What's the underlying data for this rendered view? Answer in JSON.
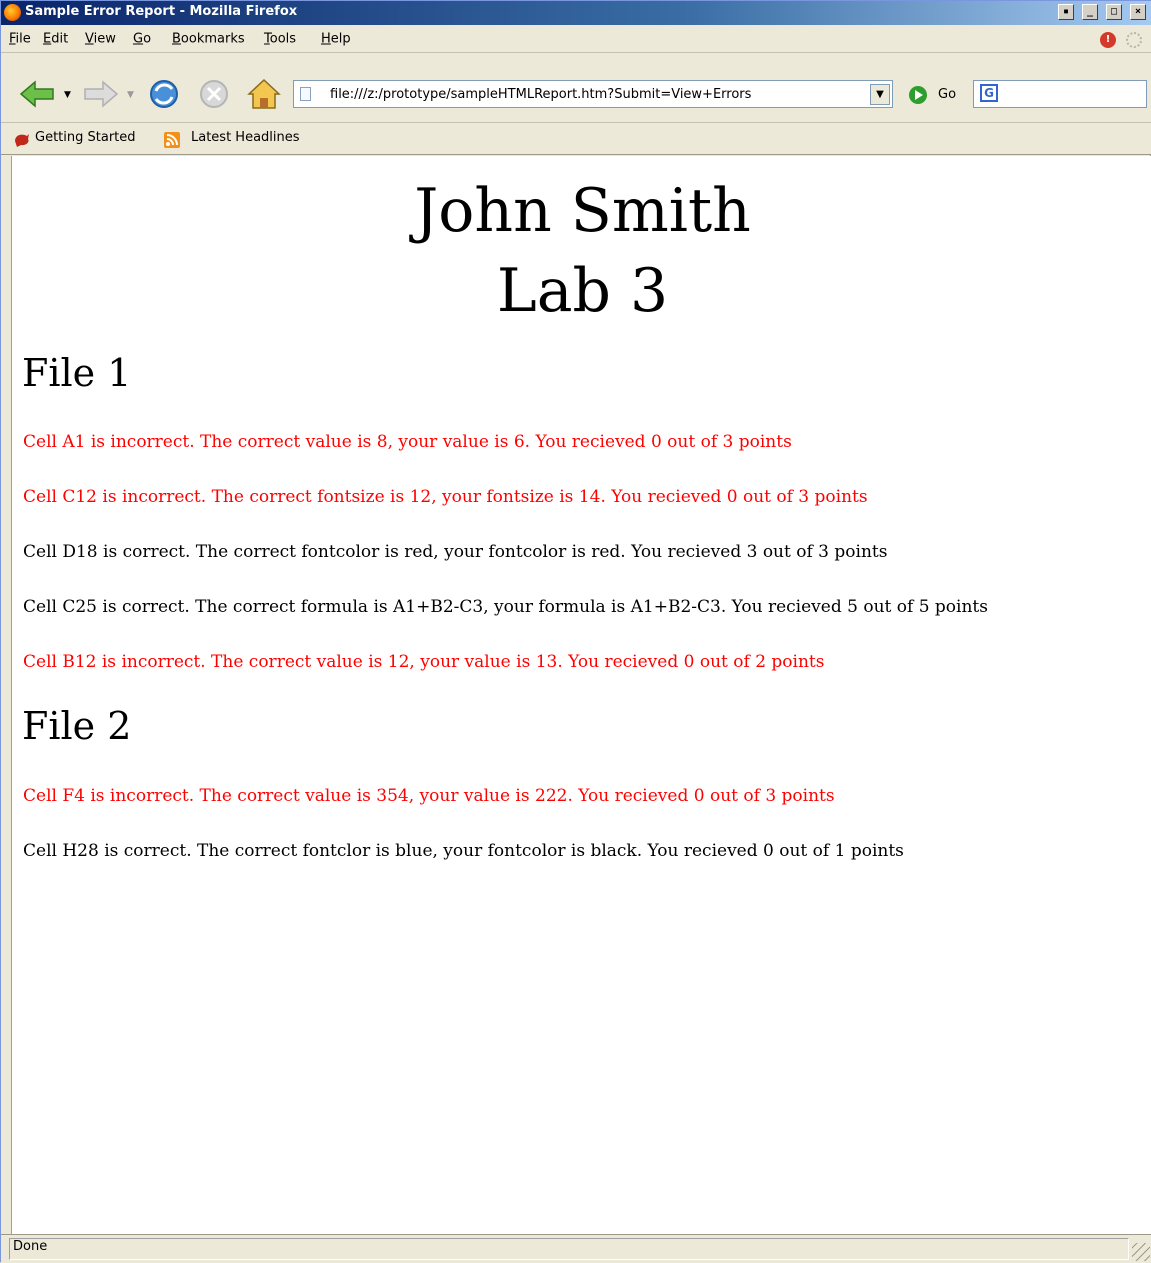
{
  "window": {
    "title": "Sample Error Report - Mozilla Firefox"
  },
  "menu": {
    "items": [
      {
        "key": "F",
        "rest": "ile"
      },
      {
        "key": "E",
        "rest": "dit"
      },
      {
        "key": "V",
        "rest": "iew"
      },
      {
        "key": "G",
        "rest": "o"
      },
      {
        "key": "B",
        "rest": "ookmarks"
      },
      {
        "key": "T",
        "rest": "ools"
      },
      {
        "key": "H",
        "rest": "elp"
      }
    ]
  },
  "toolbar": {
    "url": "file:///z:/prototype/sampleHTMLReport.htm?Submit=View+Errors",
    "go_label": "Go",
    "search_value": ""
  },
  "bookmarks": {
    "items": [
      "Getting Started",
      "Latest Headlines"
    ]
  },
  "report": {
    "name": "John Smith",
    "lab": "Lab 3",
    "files": [
      {
        "heading": "File 1",
        "lines": [
          {
            "text": "Cell A1 is incorrect. The correct value is 8, your value is 6. You recieved 0 out of 3 points",
            "status": "incorrect"
          },
          {
            "text": "Cell C12 is incorrect. The correct fontsize is 12, your fontsize is 14. You recieved 0 out of 3 points",
            "status": "incorrect"
          },
          {
            "text": "Cell D18 is correct. The correct fontcolor is red, your fontcolor is red. You recieved 3 out of 3 points",
            "status": "correct"
          },
          {
            "text": "Cell C25 is correct. The correct formula is A1+B2-C3, your formula is A1+B2-C3. You recieved 5 out of 5 points",
            "status": "correct"
          },
          {
            "text": "Cell B12 is incorrect. The correct value is 12, your value is 13. You recieved 0 out of 2 points",
            "status": "incorrect"
          }
        ]
      },
      {
        "heading": "File 2",
        "lines": [
          {
            "text": "Cell F4 is incorrect. The correct value is 354, your value is 222. You recieved 0 out of 3 points",
            "status": "incorrect"
          },
          {
            "text": "Cell H28 is correct. The correct fontclor is blue, your fontcolor is black. You recieved 0 out of 1 points",
            "status": "correct"
          }
        ]
      }
    ]
  },
  "status_bar": {
    "text": "Done"
  },
  "colors": {
    "incorrect": "#ff0000",
    "correct": "#000000"
  }
}
